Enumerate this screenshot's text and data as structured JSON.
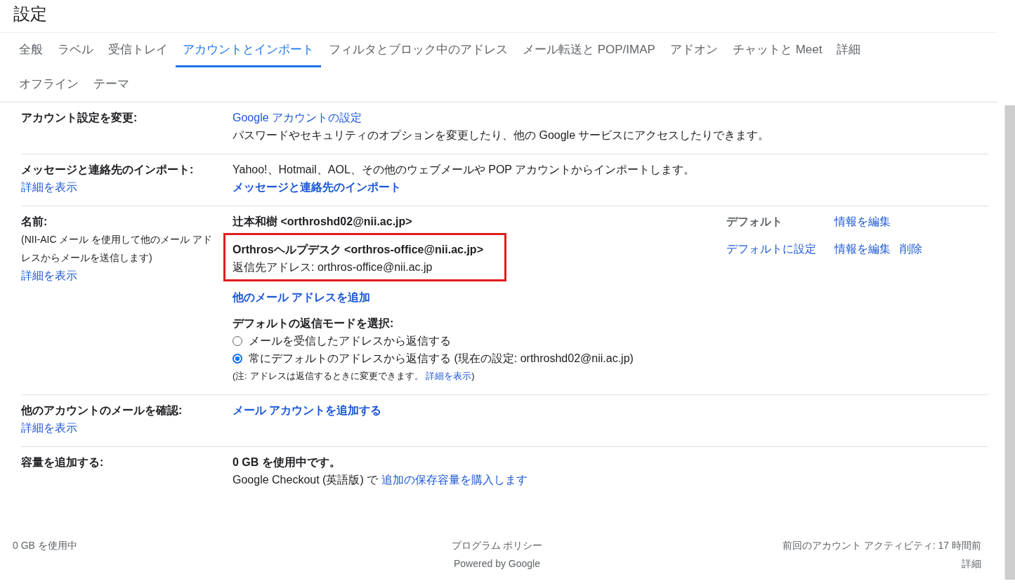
{
  "header": {
    "title": "設定"
  },
  "tabs": [
    {
      "label": "全般",
      "selected": false
    },
    {
      "label": "ラベル",
      "selected": false
    },
    {
      "label": "受信トレイ",
      "selected": false
    },
    {
      "label": "アカウントとインポート",
      "selected": true
    },
    {
      "label": "フィルタとブロック中のアドレス",
      "selected": false
    },
    {
      "label": "メール転送と POP/IMAP",
      "selected": false
    },
    {
      "label": "アドオン",
      "selected": false
    },
    {
      "label": "チャットと Meet",
      "selected": false
    },
    {
      "label": "詳細",
      "selected": false
    },
    {
      "label": "オフライン",
      "selected": false
    },
    {
      "label": "テーマ",
      "selected": false
    }
  ],
  "account_settings": {
    "label": "アカウント設定を変更:",
    "link": "Google アカウントの設定",
    "description": "パスワードやセキュリティのオプションを変更したり、他の Google サービスにアクセスしたりできます。"
  },
  "import": {
    "label": "メッセージと連絡先のインポート:",
    "details_link": "詳細を表示",
    "description": "Yahoo!、Hotmail、AOL、その他のウェブメールや POP アカウントからインポートします。",
    "action_link": "メッセージと連絡先のインポート"
  },
  "send_as": {
    "label": "名前:",
    "description_lines": [
      "(NII-AIC メール を使用して他のメール アド",
      "レスからメールを送信します)"
    ],
    "details_link": "詳細を表示",
    "addresses": [
      {
        "address": "辻本和樹 <orthroshd02@nii.ac.jp>",
        "is_default": true,
        "default_label": "デフォルト",
        "actions": [
          "情報を編集"
        ],
        "highlighted": false
      },
      {
        "address": "Orthrosヘルプデスク <orthros-office@nii.ac.jp>",
        "reply_to": "返信先アドレス: orthros-office@nii.ac.jp",
        "is_default": false,
        "default_label": "デフォルトに設定",
        "actions": [
          "情報を編集",
          "削除"
        ],
        "highlighted": true
      }
    ],
    "add_link": "他のメール アドレスを追加",
    "reply_mode": {
      "heading": "デフォルトの返信モードを選択:",
      "options": [
        {
          "label": "メールを受信したアドレスから返信する",
          "selected": false
        },
        {
          "label": "常にデフォルトのアドレスから返信する (現在の設定: orthroshd02@nii.ac.jp)",
          "selected": true
        }
      ],
      "note": "(注: アドレスは返信するときに変更できます。",
      "note_link": "詳細を表示",
      "note_end": ")"
    }
  },
  "check_mail": {
    "label": "他のアカウントのメールを確認:",
    "details_link": "詳細を表示",
    "action_link": "メール アカウントを追加する"
  },
  "storage": {
    "label": "容量を追加する:",
    "usage": "0 GB を使用中です。",
    "prefix": "Google Checkout (英語版) で",
    "link": "追加の保存容量を購入します"
  },
  "footer": {
    "storage": "0 GB を使用中",
    "policy": "プログラム ポリシー",
    "powered": "Powered by Google",
    "activity": "前回のアカウント アクティビティ: 17 時間前",
    "details": "詳細"
  }
}
